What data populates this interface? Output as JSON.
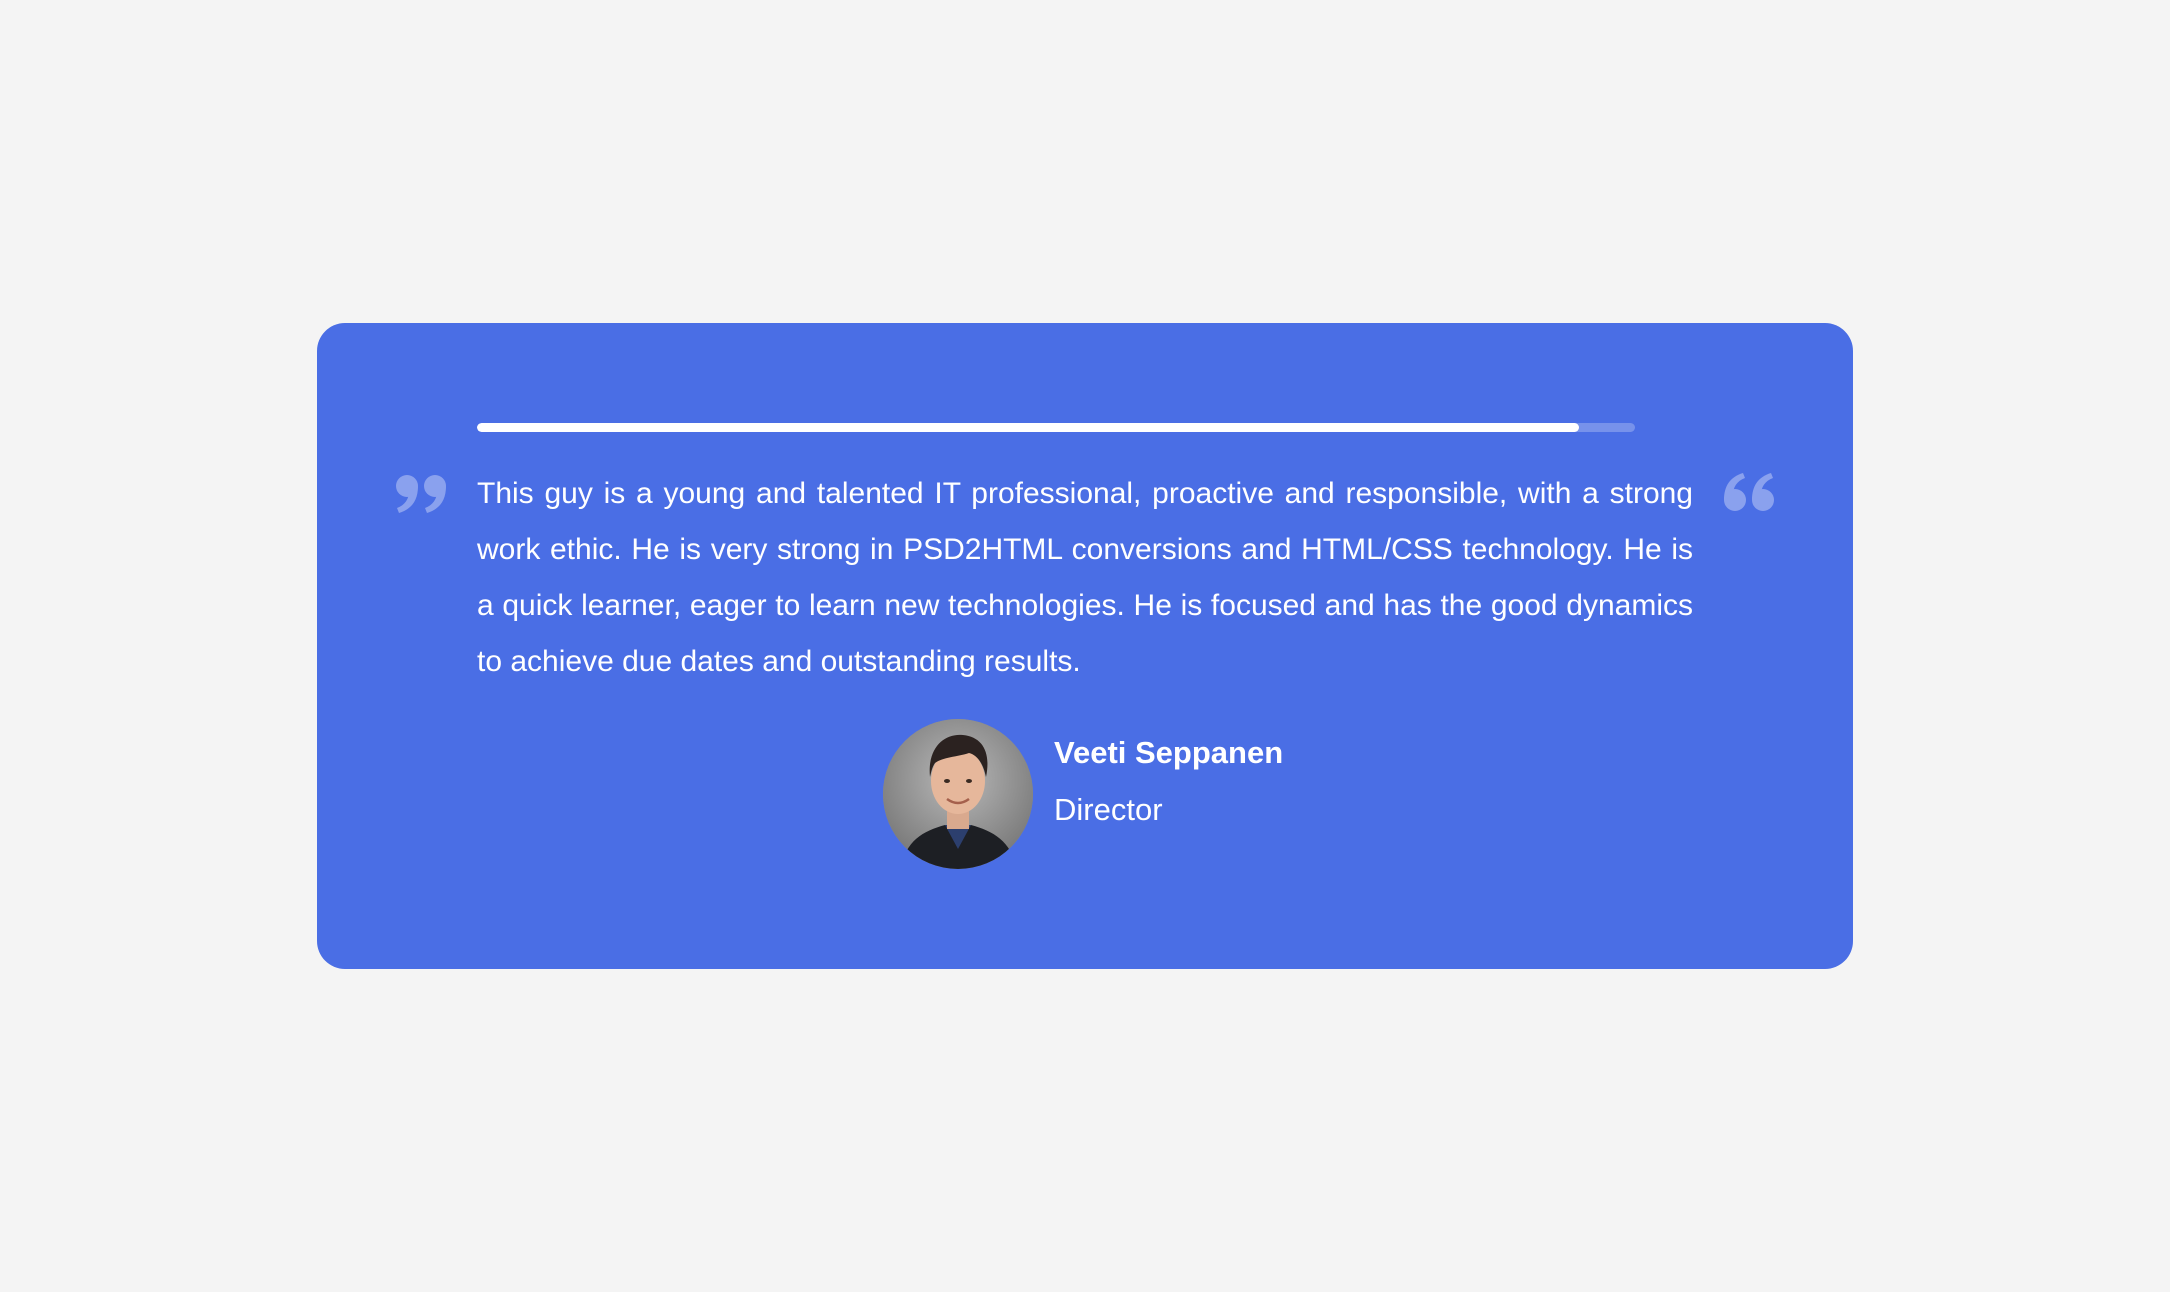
{
  "testimonial": {
    "progress": 0.952,
    "quote": "This guy is a young and talented IT professional, proactive and responsible, with a strong work ethic. He is very strong in PSD2HTML conversions and HTML/CSS technology. He is a quick learner, eager to learn new technologies. He is focused and has the good dynamics to achieve due dates and outstanding results.",
    "author_name": "Veeti Seppanen",
    "author_role": "Director"
  },
  "icons": {
    "left_quote": "quote-close-icon",
    "right_quote": "quote-open-icon"
  },
  "colors": {
    "page_background": "#f4f4f4",
    "card_background": "#4a6ee5",
    "text": "#ffffff",
    "quote_icon": "#8aa1ee"
  }
}
